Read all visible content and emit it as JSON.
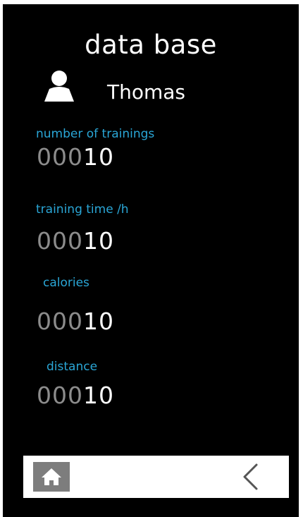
{
  "header": {
    "title": "data base"
  },
  "user": {
    "name": "Thomas",
    "icon": "user-icon"
  },
  "stats": {
    "trainings": {
      "label": "number of trainings",
      "value_dim": "000",
      "value_bright": "10"
    },
    "training_time": {
      "label": "training time /h",
      "value_dim": "000",
      "value_bright": "10"
    },
    "calories": {
      "label": "calories",
      "value_dim": "000",
      "value_bright": "10"
    },
    "distance": {
      "label": "distance",
      "value_dim": "000",
      "value_bright": "10"
    }
  },
  "nav": {
    "home_icon": "home-icon",
    "back_icon": "chevron-left-icon"
  },
  "colors": {
    "background": "#000000",
    "accent_label": "#2aa6d6",
    "text": "#ffffff",
    "dim_digits": "#8c8c8c",
    "bottom_bar": "#ffffff",
    "home_button": "#7d7d7d"
  }
}
